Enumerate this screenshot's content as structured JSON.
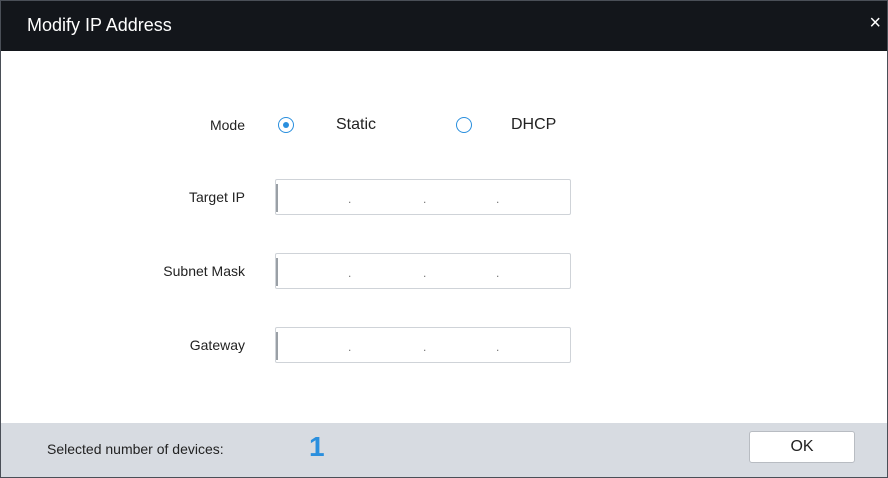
{
  "window": {
    "title": "Modify IP Address",
    "close_glyph": "×"
  },
  "form": {
    "mode_label": "Mode",
    "mode_options": [
      {
        "label": "Static",
        "selected": true
      },
      {
        "label": "DHCP",
        "selected": false
      }
    ],
    "target_ip_label": "Target IP",
    "subnet_mask_label": "Subnet Mask",
    "gateway_label": "Gateway",
    "ip_separator": "."
  },
  "footer": {
    "selected_label": "Selected number of devices:",
    "selected_count": "1",
    "ok_label": "OK"
  },
  "colors": {
    "titlebar": "#13161b",
    "accent": "#2a8fde",
    "footer": "#d7dbe1"
  }
}
